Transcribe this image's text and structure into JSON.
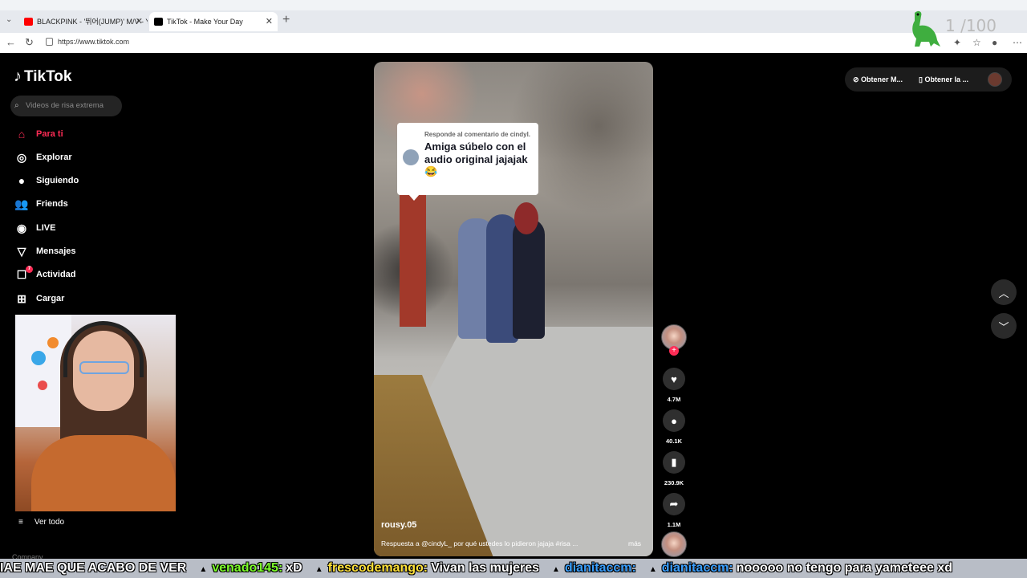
{
  "browser": {
    "tabs_menu_icon": "chevron-down",
    "tab1": {
      "title": "BLACKPINK - '뛰어(JUMP)' M/V - Y",
      "favicon_color": "#ff0000"
    },
    "tab2": {
      "title": "TikTok - Make Your Day",
      "favicon_color": "#000000"
    },
    "close_glyph": "✕",
    "new_tab_glyph": "+",
    "back_glyph": "←",
    "reload_glyph": "↻",
    "url": "https://www.tiktok.com",
    "counter": "1 /100"
  },
  "tiktok": {
    "logo_text": "TikTok",
    "search_placeholder": "Videos de risa extrema",
    "nav": [
      {
        "label": "Para ti",
        "icon": "home-icon",
        "glyph": "⌂"
      },
      {
        "label": "Explorar",
        "icon": "compass-icon",
        "glyph": "◎"
      },
      {
        "label": "Siguiendo",
        "icon": "following-avatar-icon",
        "glyph": "●"
      },
      {
        "label": "Friends",
        "icon": "friends-icon",
        "glyph": "👥"
      },
      {
        "label": "LIVE",
        "icon": "live-icon",
        "glyph": "◉"
      },
      {
        "label": "Mensajes",
        "icon": "messages-icon",
        "glyph": "▽"
      },
      {
        "label": "Actividad",
        "icon": "activity-icon",
        "glyph": "☐",
        "badge": "7"
      },
      {
        "label": "Cargar",
        "icon": "upload-icon",
        "glyph": "⊞"
      }
    ],
    "see_all": "Ver todo",
    "company": "Company",
    "top_right": {
      "get_app_1": "Obtener M...",
      "get_app_2": "Obtener la ..."
    },
    "video": {
      "comment_reply_label": "Responde al comentario de cindyl.",
      "comment_text": "Amiga súbelo con el audio original jajajak 😂",
      "username": "rousy.05",
      "description": "Respuesta a @cindyL_ por qué ustedes lo pidieron jajaja #risa ...",
      "more": "más"
    },
    "actions": {
      "likes": "4.7M",
      "comments": "40.1K",
      "saves": "230.9K",
      "shares": "1.1M"
    }
  },
  "ticker": {
    "segments": [
      {
        "user": "",
        "text": "IAE MAE QUE ACABO DE VER",
        "color": "#ffffff"
      },
      {
        "user": "venado145:",
        "text": "xD",
        "color": "#7dff2a"
      },
      {
        "user": "frescodemango:",
        "text": "Vivan las mujeres",
        "color": "#ffe23a"
      },
      {
        "user": "dianitaccm:",
        "text": "",
        "color": "#3aa0ff"
      },
      {
        "user": "dianitaccm:",
        "text": "nooooo no tengo para yameteee xd",
        "color": "#3aa0ff"
      }
    ]
  },
  "colors": {
    "accent": "#fe2c55",
    "background": "#000000"
  }
}
